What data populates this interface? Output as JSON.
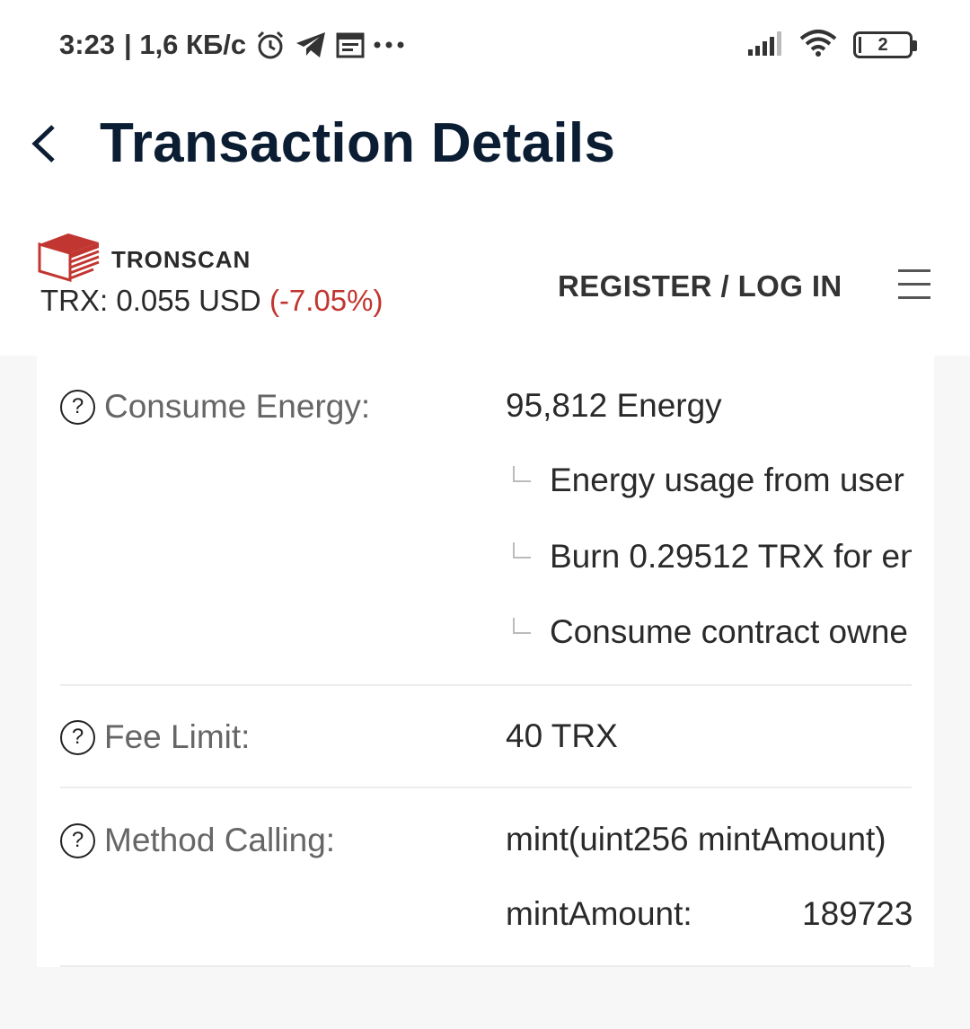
{
  "status_bar": {
    "time": "3:23",
    "network_speed": "| 1,6 КБ/с",
    "icons_left": [
      "alarm-icon",
      "telegram-icon",
      "calendar-icon",
      "more-dots-icon"
    ],
    "icons_right": [
      "signal-icon",
      "wifi-icon",
      "battery-icon"
    ],
    "battery_level": "2"
  },
  "app_header": {
    "back_icon": "chevron-left-icon",
    "title": "Transaction Details"
  },
  "site_header": {
    "logo_text": "TRONSCAN",
    "price_label": "TRX:",
    "price_value": "0.055 USD",
    "price_change": "(-7.05%)",
    "auth_link": "REGISTER / LOG IN",
    "menu_icon": "hamburger-menu-icon"
  },
  "details": {
    "consume_energy": {
      "label": "Consume Energy:",
      "value": "95,812 Energy",
      "sub_items": [
        "Energy usage from user",
        "Burn 0.29512 TRX for en",
        "Consume contract owne"
      ]
    },
    "fee_limit": {
      "label": "Fee Limit:",
      "value": "40 TRX"
    },
    "method_calling": {
      "label": "Method Calling:",
      "value": "mint(uint256 mintAmount)",
      "param_name": "mintAmount:",
      "param_value": "189723"
    }
  },
  "colors": {
    "title": "#0b1d33",
    "accent_red": "#c23631",
    "label_gray": "#666666",
    "background": "#f7f7f7"
  }
}
